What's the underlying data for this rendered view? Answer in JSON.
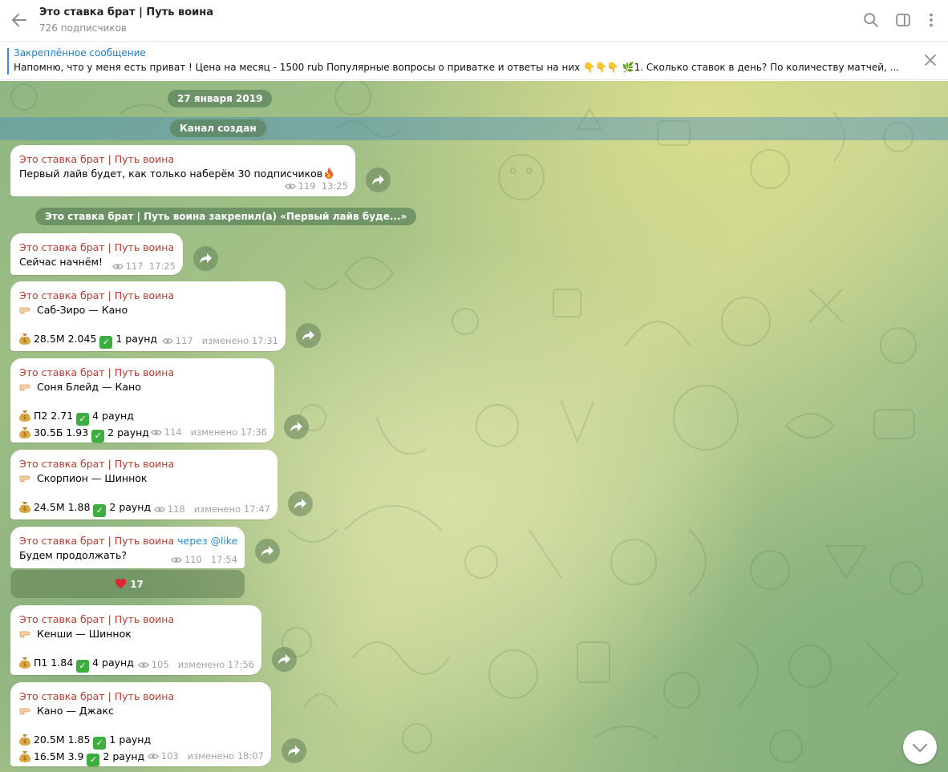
{
  "header": {
    "title": "Это ставка брат | Путь воина",
    "subscribers": "726 подписчиков",
    "icons": [
      "back-arrow-icon",
      "search-icon",
      "sidebar-toggle-icon",
      "more-vertical-icon"
    ]
  },
  "pinned": {
    "label": "Закреплённое сообщение",
    "text": "Напомню, что у меня есть приват ! Цена на месяц - 1500 rub  Популярные вопросы о приватке и ответы на них 👇👇👇 🌿1. Сколько ставок в день? По количеству матчей, ..."
  },
  "service": {
    "date": "27 января 2019",
    "created": "Канал создан",
    "pin_notice": "Это ставка брат | Путь воина закрепил(а) «Первый лайв буде...»"
  },
  "channel_name": "Это ставка брат | Путь воина",
  "messages": [
    {
      "text": "Первый лайв будет, как только наберём 30 подписчиков",
      "views": "119",
      "time": "13:25"
    },
    {
      "text": "Сейчас начнём!",
      "views": "117",
      "time": "17:25"
    },
    {
      "fight": "Саб-Зиро — Кано",
      "bets": [
        "28.5M 2.045",
        "1 раунд"
      ],
      "views": "117",
      "time": "изменено 17:31"
    },
    {
      "fight": "Соня Блейд — Кано",
      "bets": [
        "П2 2.71",
        "4 раунд",
        "30.5Б 1.93",
        "2 раунд"
      ],
      "views": "114",
      "time": "изменено 17:36"
    },
    {
      "fight": "Скорпион — Шиннок",
      "bets": [
        "24.5M 1.88",
        "2 раунд"
      ],
      "views": "118",
      "time": "изменено 17:47"
    },
    {
      "via": "через @like",
      "text": "Будем продолжать?",
      "views": "110",
      "time": "17:54"
    },
    {
      "fight": "Кенши — Шиннок",
      "bets": [
        "П1 1.84",
        "4 раунд"
      ],
      "views": "105",
      "time": "изменено 17:56"
    },
    {
      "fight": "Кано — Джакс",
      "bets": [
        "20.5M 1.85",
        "1 раунд",
        "16.5M 3.9",
        "2 раунд"
      ],
      "views": "103",
      "time": "изменено 18:07"
    }
  ],
  "reaction": {
    "emoji": "heart",
    "count": "17"
  },
  "colors": {
    "accent": "#1c7ec4",
    "author": "#c0392b",
    "check": "#3cae3f"
  }
}
